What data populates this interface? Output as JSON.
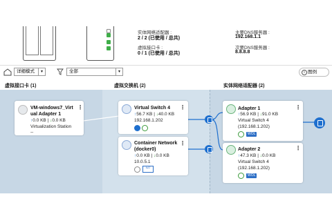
{
  "summary": {
    "physical_adapters_label": "实体网络适配器 :",
    "physical_adapters_value": "2 / 2 (已使用 / 总共)",
    "virtual_ports_label": "虚拟接口卡 :",
    "virtual_ports_value": "0 / 1 (已使用 / 总共)",
    "primary_dns_label": "主要DNS服务器 :",
    "primary_dns_value": "192.168.1.1",
    "secondary_dns_label": "次要DNS服务器 :",
    "secondary_dns_value": "8.8.8.8"
  },
  "toolbar": {
    "view_mode": "详细模式",
    "filter": "全部",
    "legend": "图例"
  },
  "columns": {
    "virtual_nics": "虚拟接口卡 (1)",
    "virtual_switches": "虚拟交换机 (2)",
    "physical_adapters": "实体网络适配器 (2)"
  },
  "vm_card": {
    "title_line1": "VM-windows7_Virt",
    "title_line2": "ual Adapter 1",
    "traffic_up": "0.0 KB",
    "traffic_down": "0.0 KB",
    "subtitle": "Virtualization Station",
    "extra": "--"
  },
  "switch_cards": [
    {
      "title": "Virtual Switch 4",
      "traffic_up": "56.7 KB",
      "traffic_down": "40.0 KB",
      "ip": "192.168.1.202"
    },
    {
      "title_line1": "Container Network",
      "title_line2": "(docker0)",
      "traffic_up": "0.0 KB",
      "traffic_down": "0.0 KB",
      "ip": "10.0.5.1",
      "nat_badge": "NAT"
    }
  ],
  "adapter_cards": [
    {
      "title": "Adapter 1",
      "traffic_up": "56.9 KB",
      "traffic_down": "91.0 KB",
      "switch": "Virtual Switch 4",
      "ip": "(192.168.1.202)",
      "wol": "WOL"
    },
    {
      "title": "Adapter 2",
      "traffic_up": "47.3 KB",
      "traffic_down": "0.0 KB",
      "switch": "Virtual Switch 4",
      "ip": "(192.168.1.202)",
      "wol": "WOL"
    }
  ],
  "symbols": {
    "sep": "|",
    "up_arrow": "↑",
    "down_arrow": "↓",
    "kebab": "⋮",
    "caret": "▾"
  },
  "colors": {
    "accent_blue": "#1e6fce",
    "upload": "#1b6fc9",
    "download": "#3a9a3a",
    "panel": "#c7d7e5"
  }
}
